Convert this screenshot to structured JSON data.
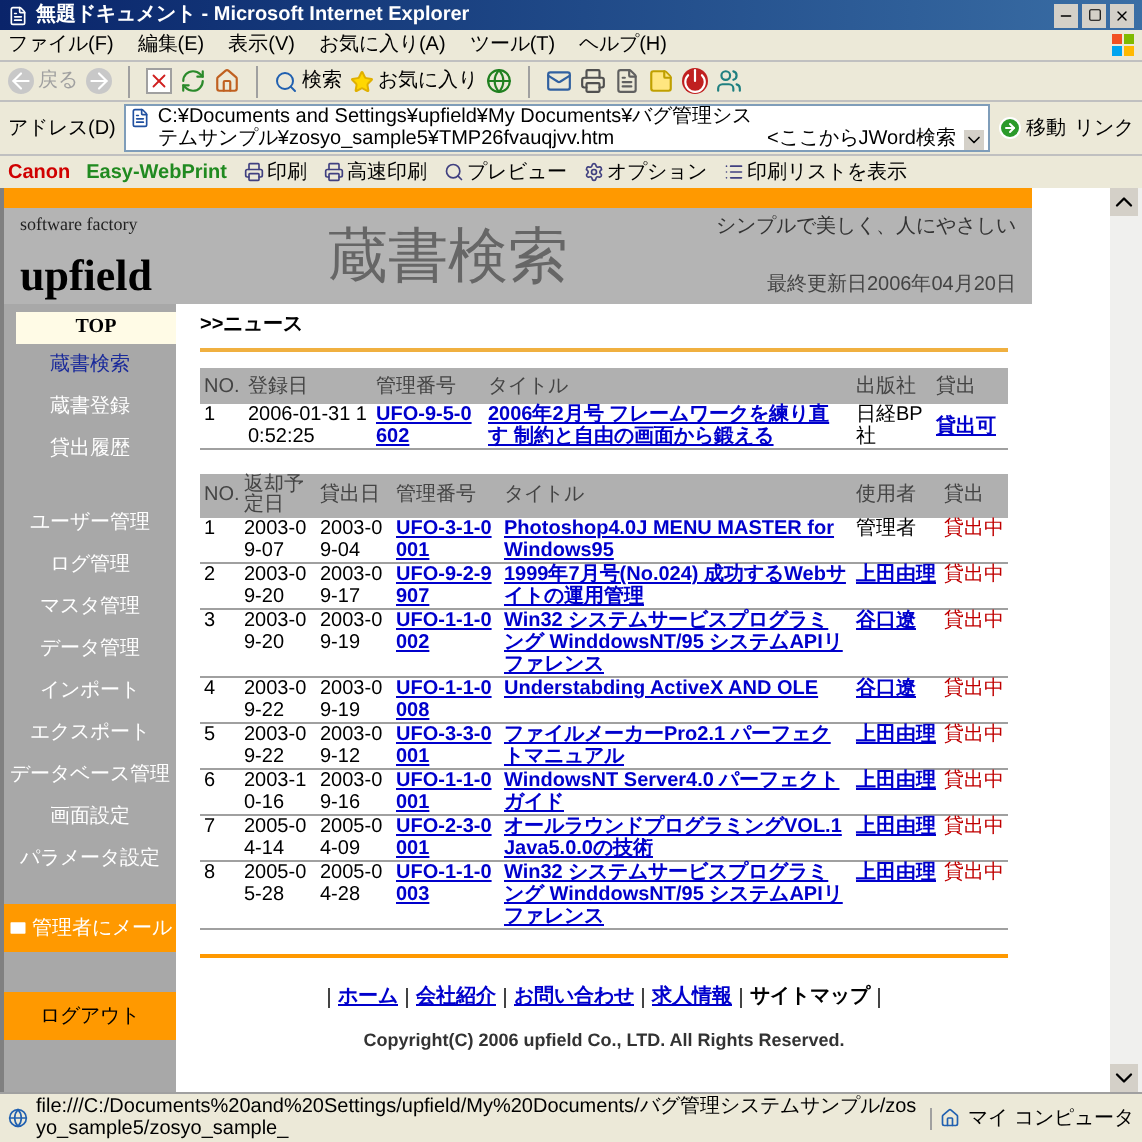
{
  "browser": {
    "title": "無題ドキュメント - Microsoft Internet Explorer",
    "menu": [
      "ファイル(F)",
      "編集(E)",
      "表示(V)",
      "お気に入り(A)",
      "ツール(T)",
      "ヘルプ(H)"
    ],
    "toolbar": {
      "back": {
        "label": "戻る",
        "disabled": true
      },
      "search": "検索",
      "favorites": "お気に入り"
    },
    "address": {
      "label": "アドレス(D)",
      "value": "C:¥Documents and Settings¥upfield¥My Documents¥バグ管理システムサンプル¥zosyo_sample5¥TMP26fvauqjvv.htm",
      "hint": "<ここからJWord検索",
      "go": "移動",
      "links": "リンク"
    },
    "print_bar": {
      "brand": "Canon",
      "product": "Easy-WebPrint",
      "buttons": [
        {
          "kind": "print",
          "label": "印刷"
        },
        {
          "kind": "fast",
          "label": "高速印刷"
        },
        {
          "kind": "preview",
          "label": "プレビュー"
        },
        {
          "kind": "options",
          "label": "オプション"
        },
        {
          "kind": "list",
          "label": "印刷リストを表示"
        }
      ]
    },
    "status_bar": {
      "url": "file:///C:/Documents%20and%20Settings/upfield/My%20Documents/バグ管理システムサンプル/zosyo_sample5/zosyo_sample_",
      "zone": "マイ コンピュータ"
    }
  },
  "header": {
    "company": "software factory",
    "logo": "upfield",
    "title": "蔵書検索",
    "tagline": "シンプルで美しく、人にやさしい",
    "updated": "最終更新日2006年04月20日"
  },
  "sidebar": {
    "top": "TOP",
    "groups": [
      [
        {
          "label": "蔵書検索",
          "selected": true
        },
        {
          "label": "蔵書登録",
          "selected": false
        },
        {
          "label": "貸出履歴",
          "selected": false
        }
      ],
      [
        {
          "label": "ユーザー管理",
          "selected": false
        },
        {
          "label": "ログ管理",
          "selected": false
        },
        {
          "label": "マスタ管理",
          "selected": false
        },
        {
          "label": "データ管理",
          "selected": false
        },
        {
          "label": "インポート",
          "selected": false
        },
        {
          "label": "エクスポート",
          "selected": false
        },
        {
          "label": "データベース管理",
          "selected": false
        },
        {
          "label": "画面設定",
          "selected": false
        },
        {
          "label": "パラメータ設定",
          "selected": false
        }
      ]
    ],
    "mail": "管理者にメール",
    "logout": "ログアウト"
  },
  "news": {
    "heading": ">>ニュース",
    "columns": [
      "NO.",
      "登録日",
      "管理番号",
      "タイトル",
      "出版社",
      "貸出"
    ],
    "rows": [
      {
        "no": "1",
        "date": "2006-01-31 10:52:25",
        "id": "UFO-9-5-0602",
        "title": "2006年2月号 フレームワークを練り直す 制約と自由の画面から鍛える",
        "publisher": "日経BP社",
        "status": "貸出可"
      }
    ]
  },
  "loans": {
    "columns": [
      "NO.",
      "返却予定日",
      "貸出日",
      "管理番号",
      "タイトル",
      "使用者",
      "貸出"
    ],
    "rows": [
      {
        "no": "1",
        "due": "2003-09-07",
        "lent": "2003-09-04",
        "id": "UFO-3-1-0001",
        "title": "Photoshop4.0J MENU MASTER for Windows95",
        "user": "管理者",
        "user_linked": false,
        "status": "貸出中"
      },
      {
        "no": "2",
        "due": "2003-09-20",
        "lent": "2003-09-17",
        "id": "UFO-9-2-9907",
        "title": "1999年7月号(No.024) 成功するWebサイトの運用管理",
        "user": "上田由理",
        "user_linked": true,
        "status": "貸出中"
      },
      {
        "no": "3",
        "due": "2003-09-20",
        "lent": "2003-09-19",
        "id": "UFO-1-1-0002",
        "title": "Win32 システムサービスプログラミング WinddowsNT/95 システムAPIリファレンス",
        "user": "谷口遼",
        "user_linked": true,
        "status": "貸出中"
      },
      {
        "no": "4",
        "due": "2003-09-22",
        "lent": "2003-09-19",
        "id": "UFO-1-1-0008",
        "title": "Understabding ActiveX AND OLE",
        "user": "谷口遼",
        "user_linked": true,
        "status": "貸出中"
      },
      {
        "no": "5",
        "due": "2003-09-22",
        "lent": "2003-09-12",
        "id": "UFO-3-3-0001",
        "title": "ファイルメーカーPro2.1 パーフェクトマニュアル",
        "user": "上田由理",
        "user_linked": true,
        "status": "貸出中"
      },
      {
        "no": "6",
        "due": "2003-10-16",
        "lent": "2003-09-16",
        "id": "UFO-1-1-0001",
        "title": "WindowsNT Server4.0 パーフェクトガイド",
        "user": "上田由理",
        "user_linked": true,
        "status": "貸出中"
      },
      {
        "no": "7",
        "due": "2005-04-14",
        "lent": "2005-04-09",
        "id": "UFO-2-3-0001",
        "title": "オールラウンドプログラミングVOL.1 Java5.0.0の技術",
        "user": "上田由理",
        "user_linked": true,
        "status": "貸出中"
      },
      {
        "no": "8",
        "due": "2005-05-28",
        "lent": "2005-04-28",
        "id": "UFO-1-1-0003",
        "title": "Win32 システムサービスプログラミング WinddowsNT/95 システムAPIリファレンス",
        "user": "上田由理",
        "user_linked": true,
        "status": "貸出中"
      }
    ]
  },
  "footer": {
    "links": [
      {
        "label": "ホーム",
        "selected": false
      },
      {
        "label": "会社紹介",
        "selected": false
      },
      {
        "label": "お問い合わせ",
        "selected": false
      },
      {
        "label": "求人情報",
        "selected": false
      },
      {
        "label": "サイトマップ",
        "selected": true
      }
    ],
    "copyright": "Copyright(C) 2006 upfield Co., LTD. All Rights Reserved."
  }
}
